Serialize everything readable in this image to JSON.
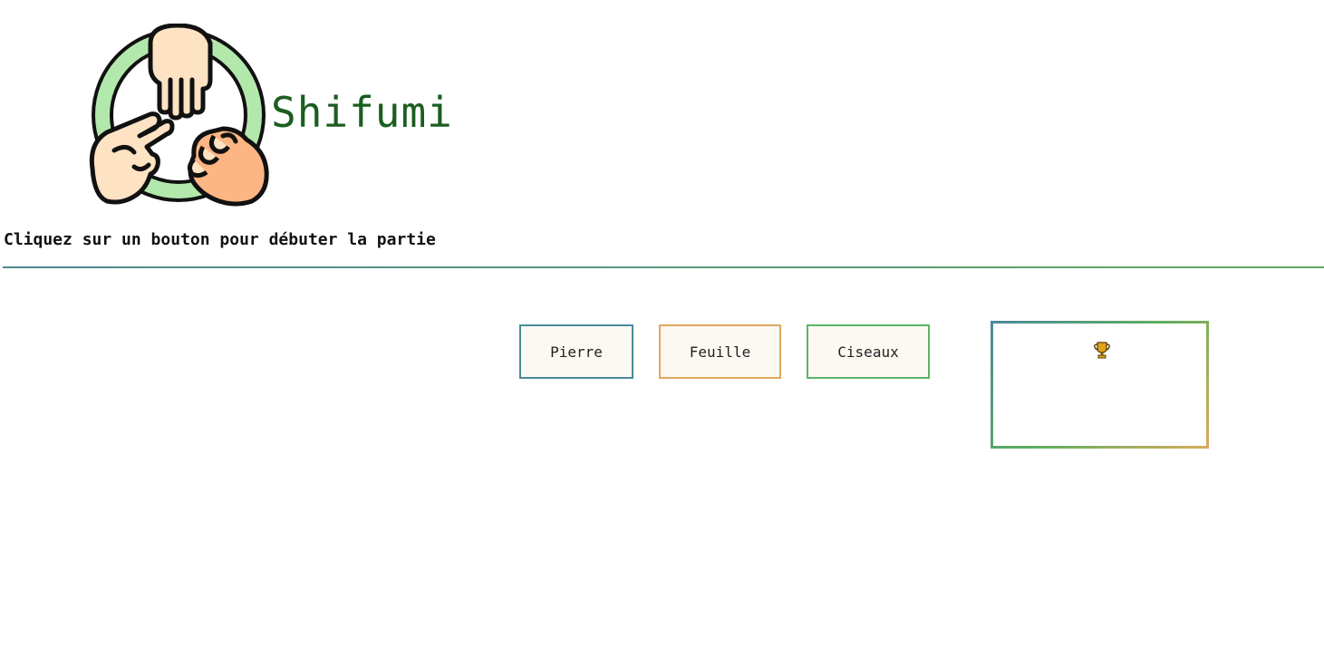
{
  "header": {
    "title": "Shifumi",
    "title_color": "#1b5e20",
    "logo_icon": "rock-paper-scissors-hands-icon"
  },
  "instruction": "Cliquez sur un bouton pour débuter la partie",
  "choices": [
    {
      "label": "Pierre",
      "border_color": "#4b8a9b"
    },
    {
      "label": "Feuille",
      "border_color": "#e1a85e"
    },
    {
      "label": "Ciseaux",
      "border_color": "#5ab563"
    }
  ],
  "scoreboard": {
    "icon": "trophy-icon",
    "gradient_colors": [
      "#4b8a9b",
      "#5eae5e",
      "#d8ad5d"
    ]
  },
  "colors": {
    "divider_start": "#4b8a93",
    "divider_end": "#5eaa62",
    "button_bg": "#fcf9f3"
  }
}
